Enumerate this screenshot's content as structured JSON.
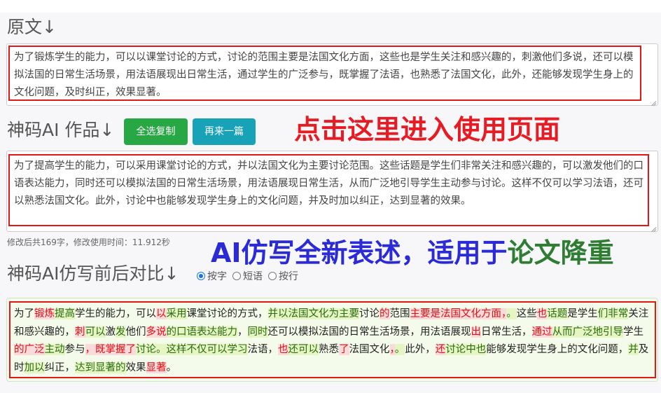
{
  "original": {
    "heading": "原文↓",
    "text": "为了锻炼学生的能力，可以以课堂讨论的方式，讨论的范围主要是法国文化方面，这些也是学生关注和感兴趣的，刺激他们多说，还可以模拟法国的日常生活场景，用法语展现出日常生活，通过学生的广泛参与，既掌握了法语，也熟悉了法国文化，此外，还能够发现学生身上的文化问题，及时纠正，效果显著。"
  },
  "ai_output": {
    "heading": "神码AI 作品↓",
    "copy_button": "全选复制",
    "again_button": "再来一篇",
    "text": "为了提高学生的能力，可以采用课堂讨论的方式，并以法国文化为主要讨论范围。这些话题是学生们非常关注和感兴趣的，可以激发他们的口语表达能力，同时还可以模拟法国的日常生活场景，用法语展现日常生活，从而广泛地引导学生主动参与讨论。这样不仅可以学习法语，还可以熟悉法国文化。此外，讨论中也能够发现学生身上的文化问题，并及时加以纠正，达到显著的效果。",
    "meta": "修改后共169字，修改使用时间：11.912秒"
  },
  "promo": {
    "click_here": "点击这里进入使用页面",
    "rewrite_part1": "AI仿写全新表述，适用于",
    "rewrite_part2": "论文降重",
    "colors": {
      "red": "#e51c23",
      "blue": "#2a2ad6",
      "green": "#2e7d32"
    }
  },
  "compare": {
    "heading": "神码AI仿写前后对比↓",
    "options": [
      "按字",
      "短语",
      "按行"
    ],
    "selected": "按字",
    "segments": [
      {
        "t": "为了",
        "k": "s"
      },
      {
        "t": "锻炼",
        "k": "d"
      },
      {
        "t": "提高",
        "k": "i"
      },
      {
        "t": "学生的能力，可以",
        "k": "s"
      },
      {
        "t": "以",
        "k": "d"
      },
      {
        "t": "采用",
        "k": "i"
      },
      {
        "t": "课堂讨论的方式，",
        "k": "s"
      },
      {
        "t": "并以法国文化为主要",
        "k": "i"
      },
      {
        "t": "讨论",
        "k": "s"
      },
      {
        "t": "的",
        "k": "d"
      },
      {
        "t": "范围",
        "k": "s"
      },
      {
        "t": "主要是法国文化方面，",
        "k": "d"
      },
      {
        "t": "。",
        "k": "i"
      },
      {
        "t": "这些",
        "k": "s"
      },
      {
        "t": "也",
        "k": "d"
      },
      {
        "t": "话题",
        "k": "i"
      },
      {
        "t": "是学生",
        "k": "s"
      },
      {
        "t": "们非常",
        "k": "i"
      },
      {
        "t": "关注和感兴趣的，",
        "k": "s"
      },
      {
        "t": "刺",
        "k": "d"
      },
      {
        "t": "可以",
        "k": "i"
      },
      {
        "t": "激",
        "k": "s"
      },
      {
        "t": "发",
        "k": "i"
      },
      {
        "t": "他们",
        "k": "s"
      },
      {
        "t": "多说",
        "k": "d"
      },
      {
        "t": "的口语表达能力",
        "k": "i"
      },
      {
        "t": "，",
        "k": "s"
      },
      {
        "t": "同时",
        "k": "i"
      },
      {
        "t": "还可以模拟法国的日常生活场景，用法语展现",
        "k": "s"
      },
      {
        "t": "出",
        "k": "d"
      },
      {
        "t": "日常生活，",
        "k": "s"
      },
      {
        "t": "通过",
        "k": "d"
      },
      {
        "t": "从而广泛地引导",
        "k": "i"
      },
      {
        "t": "学生",
        "k": "s"
      },
      {
        "t": "的",
        "k": "d"
      },
      {
        "t": "广泛",
        "k": "d"
      },
      {
        "t": "主动",
        "k": "i"
      },
      {
        "t": "参与",
        "k": "s"
      },
      {
        "t": "，既掌握了",
        "k": "d"
      },
      {
        "t": "讨论。这样不仅可以学习",
        "k": "i"
      },
      {
        "t": "法语，",
        "k": "s"
      },
      {
        "t": "也",
        "k": "d"
      },
      {
        "t": "还可以",
        "k": "i"
      },
      {
        "t": "熟悉",
        "k": "s"
      },
      {
        "t": "了",
        "k": "d"
      },
      {
        "t": "法国文化",
        "k": "s"
      },
      {
        "t": "，",
        "k": "d"
      },
      {
        "t": "。",
        "k": "i"
      },
      {
        "t": "此外，",
        "k": "s"
      },
      {
        "t": "还",
        "k": "d"
      },
      {
        "t": "讨论中也",
        "k": "i"
      },
      {
        "t": "能够发现学生身上的文化问题，",
        "k": "s"
      },
      {
        "t": "并",
        "k": "i"
      },
      {
        "t": "及时",
        "k": "s"
      },
      {
        "t": "加以",
        "k": "i"
      },
      {
        "t": "纠正，",
        "k": "s"
      },
      {
        "t": "达到显著的",
        "k": "i"
      },
      {
        "t": "效果",
        "k": "s"
      },
      {
        "t": "显著",
        "k": "d"
      },
      {
        "t": "。",
        "k": "s"
      }
    ]
  }
}
